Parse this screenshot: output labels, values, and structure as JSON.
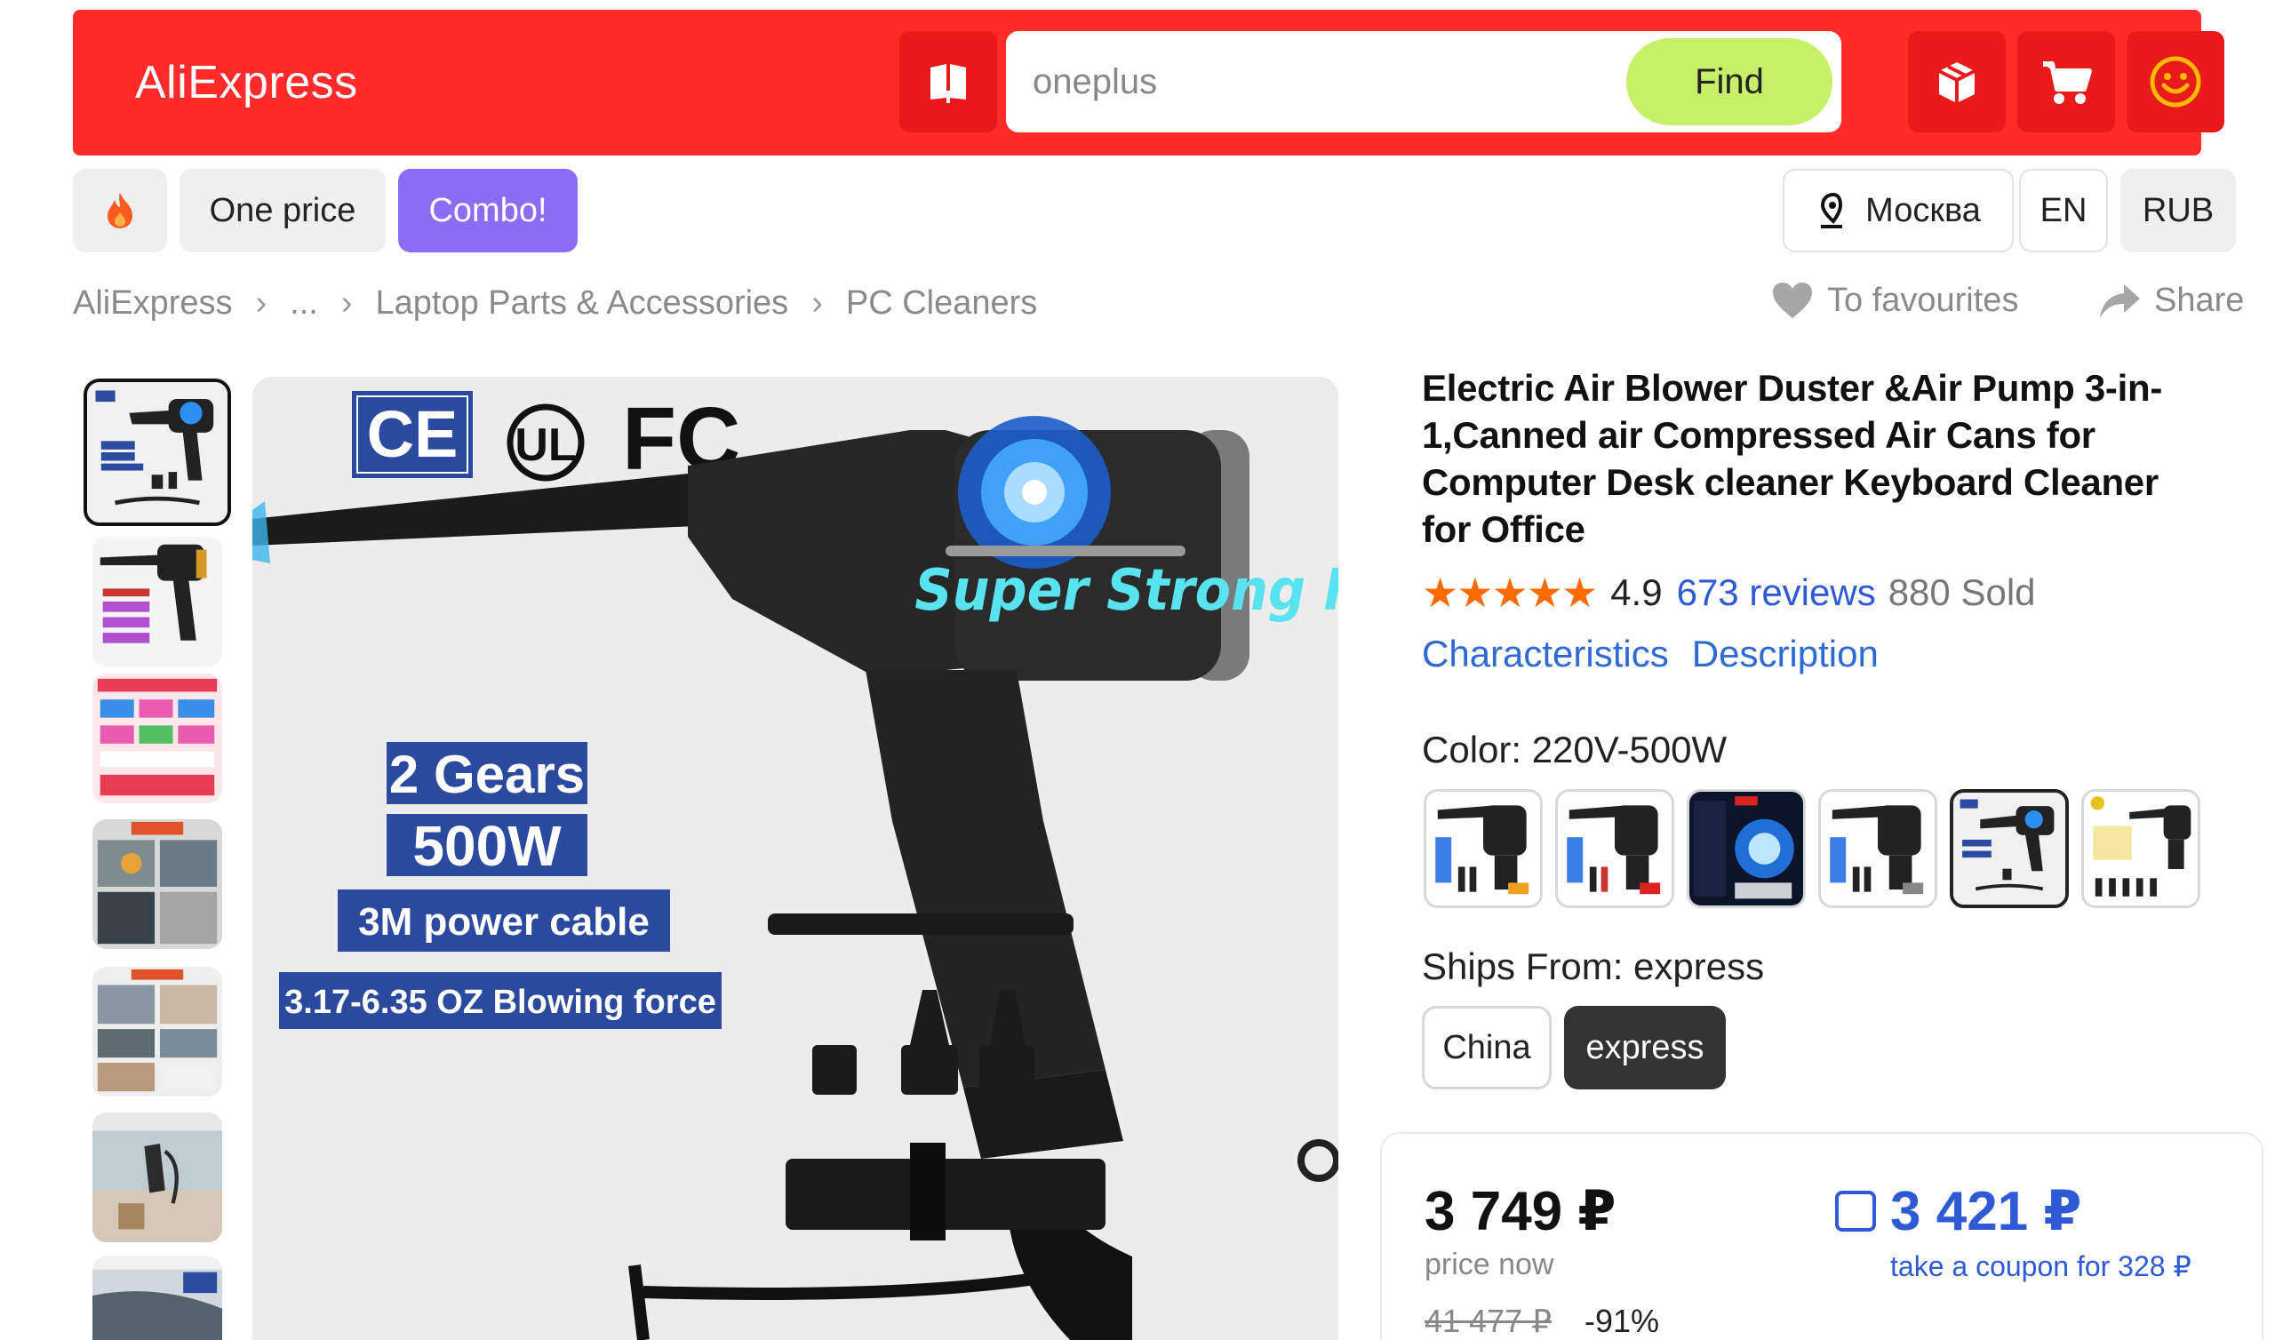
{
  "header": {
    "logo": "AliExpress",
    "search_value": "oneplus",
    "find_label": "Find"
  },
  "pills": {
    "hot_icon": "fire-icon",
    "one_price": "One price",
    "combo": "Combo!",
    "location": "Москва",
    "language": "EN",
    "currency": "RUB"
  },
  "breadcrumbs": [
    "AliExpress",
    "...",
    "Laptop Parts & Accessories",
    "PC Cleaners"
  ],
  "actions": {
    "favourites": "To favourites",
    "share": "Share"
  },
  "main_image": {
    "text_lines": [
      "Super Strong Force",
      "2 Gears",
      "500W",
      "3M power cable",
      "3.17-6.35 OZ Blowing force"
    ],
    "badges": [
      "CE",
      "UL",
      "FC"
    ]
  },
  "product": {
    "title": "Electric Air Blower Duster &Air Pump 3-in-1,Canned air Compressed Air Cans for Computer Desk cleaner Keyboard Cleaner for Office",
    "stars": "★★★★★",
    "rating": "4.9",
    "reviews": "673 reviews",
    "sold": "880 Sold",
    "tabs": [
      "Characteristics",
      "Description"
    ],
    "color_label": "Color: 220V-500W",
    "ships_label": "Ships From: express",
    "ships_options": [
      "China",
      "express"
    ]
  },
  "price": {
    "now": "3 749 ₽",
    "now_label": "price now",
    "old": "41 477 ₽",
    "discount": "-91%",
    "coupon_price": "3 421 ₽",
    "coupon_label": "take a coupon for 328 ₽"
  },
  "colors": {
    "header_red": "#ff2a2a",
    "find_green": "#c6f067",
    "combo_purple": "#8d6cf5",
    "link_blue": "#2e5ad6",
    "star_orange": "#ff6a00"
  }
}
